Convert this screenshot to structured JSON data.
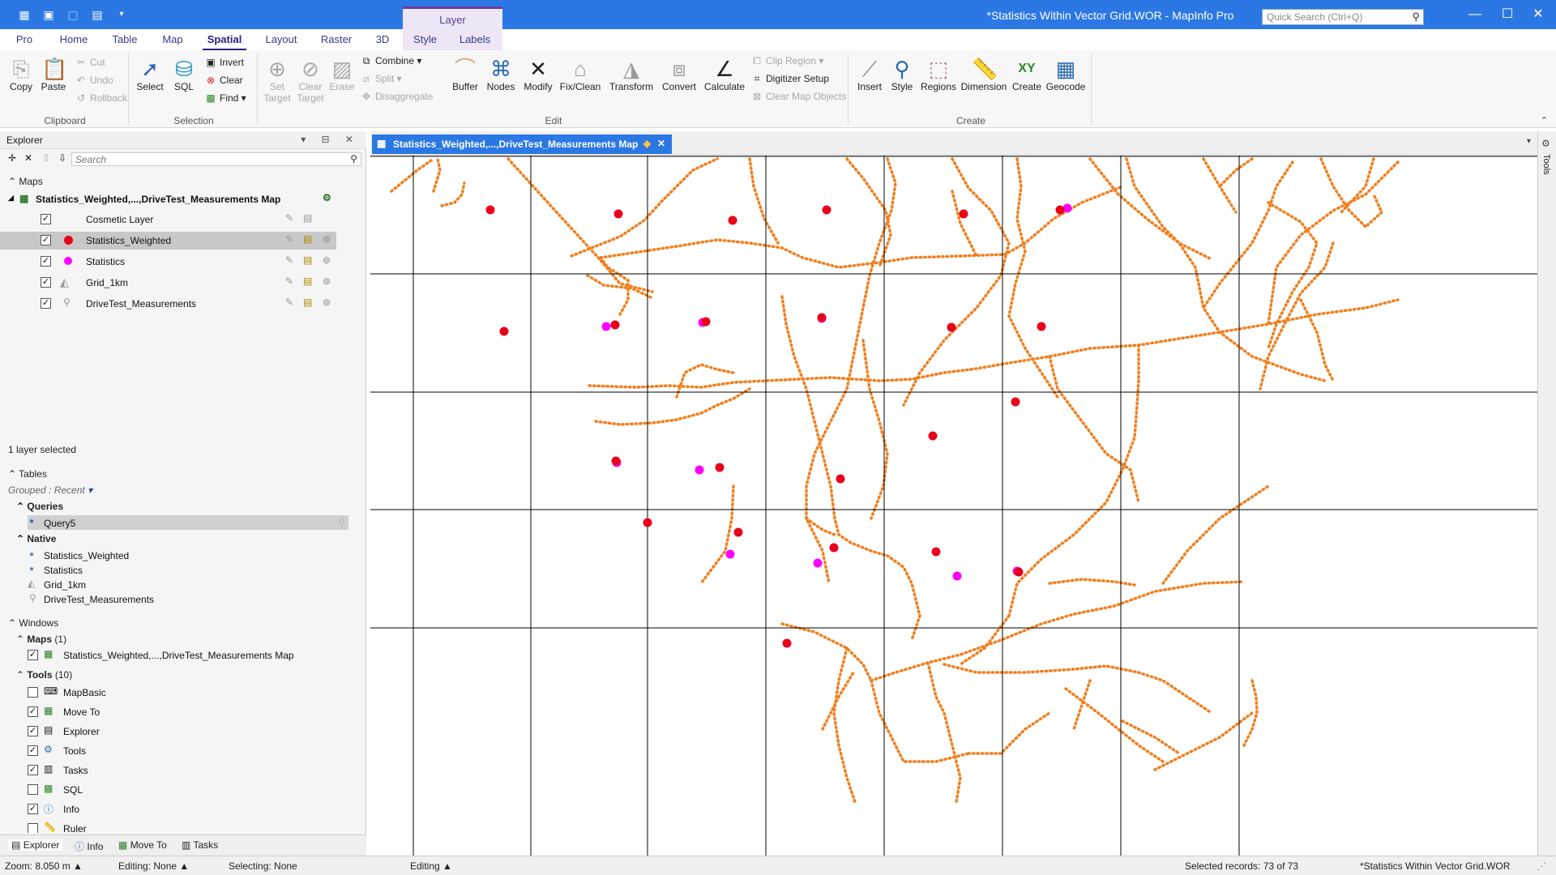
{
  "window": {
    "title": "*Statistics Within Vector Grid.WOR - MapInfo Pro",
    "quick_search_placeholder": "Quick Search (Ctrl+Q)",
    "context_group": "Layer"
  },
  "ribbon_tabs": [
    "Pro",
    "Home",
    "Table",
    "Map",
    "Spatial",
    "Layout",
    "Raster",
    "3D",
    "Style",
    "Labels"
  ],
  "ribbon": {
    "clipboard": {
      "copy": "Copy",
      "paste": "Paste",
      "cut": "Cut",
      "undo": "Undo",
      "rollback": "Rollback",
      "group": "Clipboard"
    },
    "selection": {
      "select": "Select",
      "sql": "SQL",
      "invert": "Invert",
      "clear": "Clear",
      "find": "Find",
      "group": "Selection"
    },
    "edit": {
      "set_target_1": "Set",
      "set_target_2": "Target",
      "clear_target_1": "Clear",
      "clear_target_2": "Target",
      "erase": "Erase",
      "combine": "Combine",
      "split": "Split",
      "disaggregate": "Disaggregate",
      "buffer": "Buffer",
      "nodes": "Nodes",
      "modify": "Modify",
      "fixclean": "Fix/Clean",
      "transform": "Transform",
      "convert": "Convert",
      "calculate": "Calculate",
      "clip_region": "Clip Region",
      "digitizer_setup": "Digitizer Setup",
      "clear_map_objects": "Clear Map Objects",
      "group": "Edit"
    },
    "create": {
      "insert": "Insert",
      "style": "Style",
      "regions": "Regions",
      "dimension": "Dimension",
      "create": "Create",
      "geocode": "Geocode",
      "group": "Create"
    }
  },
  "explorer": {
    "title": "Explorer",
    "search_placeholder": "Search",
    "maps_label": "Maps",
    "map_name": "Statistics_Weighted,...,DriveTest_Measurements Map",
    "layers": [
      {
        "name": "Cosmetic Layer",
        "checked": true,
        "selected": false
      },
      {
        "name": "Statistics_Weighted",
        "checked": true,
        "selected": true
      },
      {
        "name": "Statistics",
        "checked": true,
        "selected": false
      },
      {
        "name": "Grid_1km",
        "checked": true,
        "selected": false
      },
      {
        "name": "DriveTest_Measurements",
        "checked": true,
        "selected": false
      }
    ],
    "layer_status": "1 layer selected",
    "tables_label": "Tables",
    "grouped": "Grouped : Recent",
    "queries_label": "Queries",
    "queries": [
      "Query5"
    ],
    "native_label": "Native",
    "native": [
      "Statistics_Weighted",
      "Statistics",
      "Grid_1km",
      "DriveTest_Measurements"
    ],
    "windows_label": "Windows",
    "maps_win_label": "Maps",
    "maps_win_count": "(1)",
    "maps_win_item": "Statistics_Weighted,...,DriveTest_Measurements Map",
    "tools_label": "Tools",
    "tools_count": "(10)",
    "tools": [
      {
        "name": "MapBasic",
        "checked": false
      },
      {
        "name": "Move To",
        "checked": true
      },
      {
        "name": "Explorer",
        "checked": true
      },
      {
        "name": "Tools",
        "checked": true
      },
      {
        "name": "Tasks",
        "checked": true
      },
      {
        "name": "SQL",
        "checked": false
      },
      {
        "name": "Info",
        "checked": true
      },
      {
        "name": "Ruler",
        "checked": false
      }
    ],
    "bottom_tabs": [
      "Explorer",
      "Info",
      "Move To",
      "Tasks"
    ]
  },
  "map": {
    "tab_title": "Statistics_Weighted,...,DriveTest_Measurements Map",
    "side_label": "Tools",
    "colors": {
      "route": "#f08020",
      "weighted": "#e8001a",
      "stat": "#ff00ff",
      "grid": "#000000"
    }
  },
  "status": {
    "zoom": "Zoom: 8.050 m",
    "editing_none": "Editing: None",
    "selecting": "Selecting: None",
    "editing": "Editing",
    "selected": "Selected records: 73 of 73",
    "workspace": "*Statistics Within Vector Grid.WOR"
  }
}
